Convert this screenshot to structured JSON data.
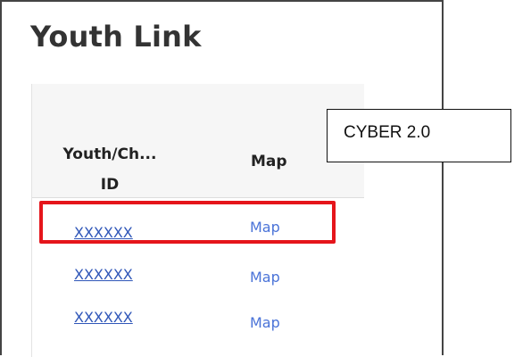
{
  "panel": {
    "title": "Youth Link"
  },
  "table": {
    "columns": {
      "id_line1": "Youth/Ch...",
      "id_line2": "ID",
      "map": "Map"
    },
    "rows": [
      {
        "id": "XXXXXX",
        "map": "Map"
      },
      {
        "id": "XXXXXX",
        "map": "Map"
      },
      {
        "id": "XXXXXX",
        "map": "Map"
      }
    ]
  },
  "callout": {
    "text": "CYBER 2.0"
  },
  "colors": {
    "link": "#2f56b8",
    "map_link": "#4a73d8",
    "highlight": "#e5151b"
  }
}
